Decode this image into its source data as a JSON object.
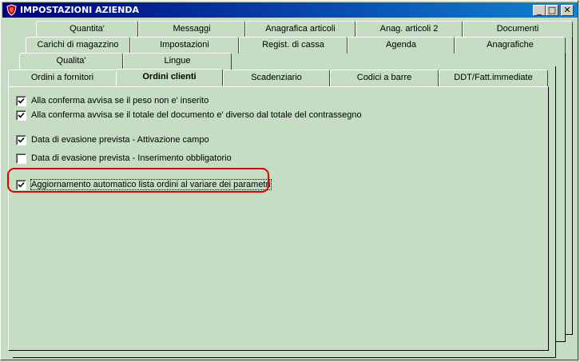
{
  "window": {
    "title": "IMPOSTAZIONI AZIENDA",
    "controls": {
      "minimize": "_",
      "maximize": "□",
      "close": "✕"
    }
  },
  "tabs": {
    "row1": [
      "Quantita'",
      "Messaggi",
      "Anagrafica articoli",
      "Anag. articoli 2",
      "Documenti"
    ],
    "row2": [
      "Carichi di magazzino",
      "Impostazioni",
      "Regist. di cassa",
      "Agenda",
      "Anagrafiche"
    ],
    "row3": [
      "Qualita'",
      "Lingue"
    ],
    "row4": [
      "Ordini a fornitori",
      "Ordini clienti",
      "Scadenziario",
      "Codici a barre",
      "DDT/Fatt.immediate"
    ],
    "active": "Ordini clienti"
  },
  "options": [
    {
      "label": "Alla conferma avvisa se il peso non e' inserito",
      "checked": true
    },
    {
      "label": "Alla conferma avvisa se il totale del documento e' diverso dal totale del contrassegno",
      "checked": true
    },
    {
      "label": "Data di evasione prevista - Attivazione campo",
      "checked": true
    },
    {
      "label": "Data di evasione prevista - Inserimento obbligatorio",
      "checked": false
    },
    {
      "label": "Aggiornamento automatico lista ordini al variare dei parametri",
      "checked": true,
      "focused": true
    }
  ],
  "colors": {
    "panel": "#c5ddc3",
    "highlight": "#e00000"
  }
}
